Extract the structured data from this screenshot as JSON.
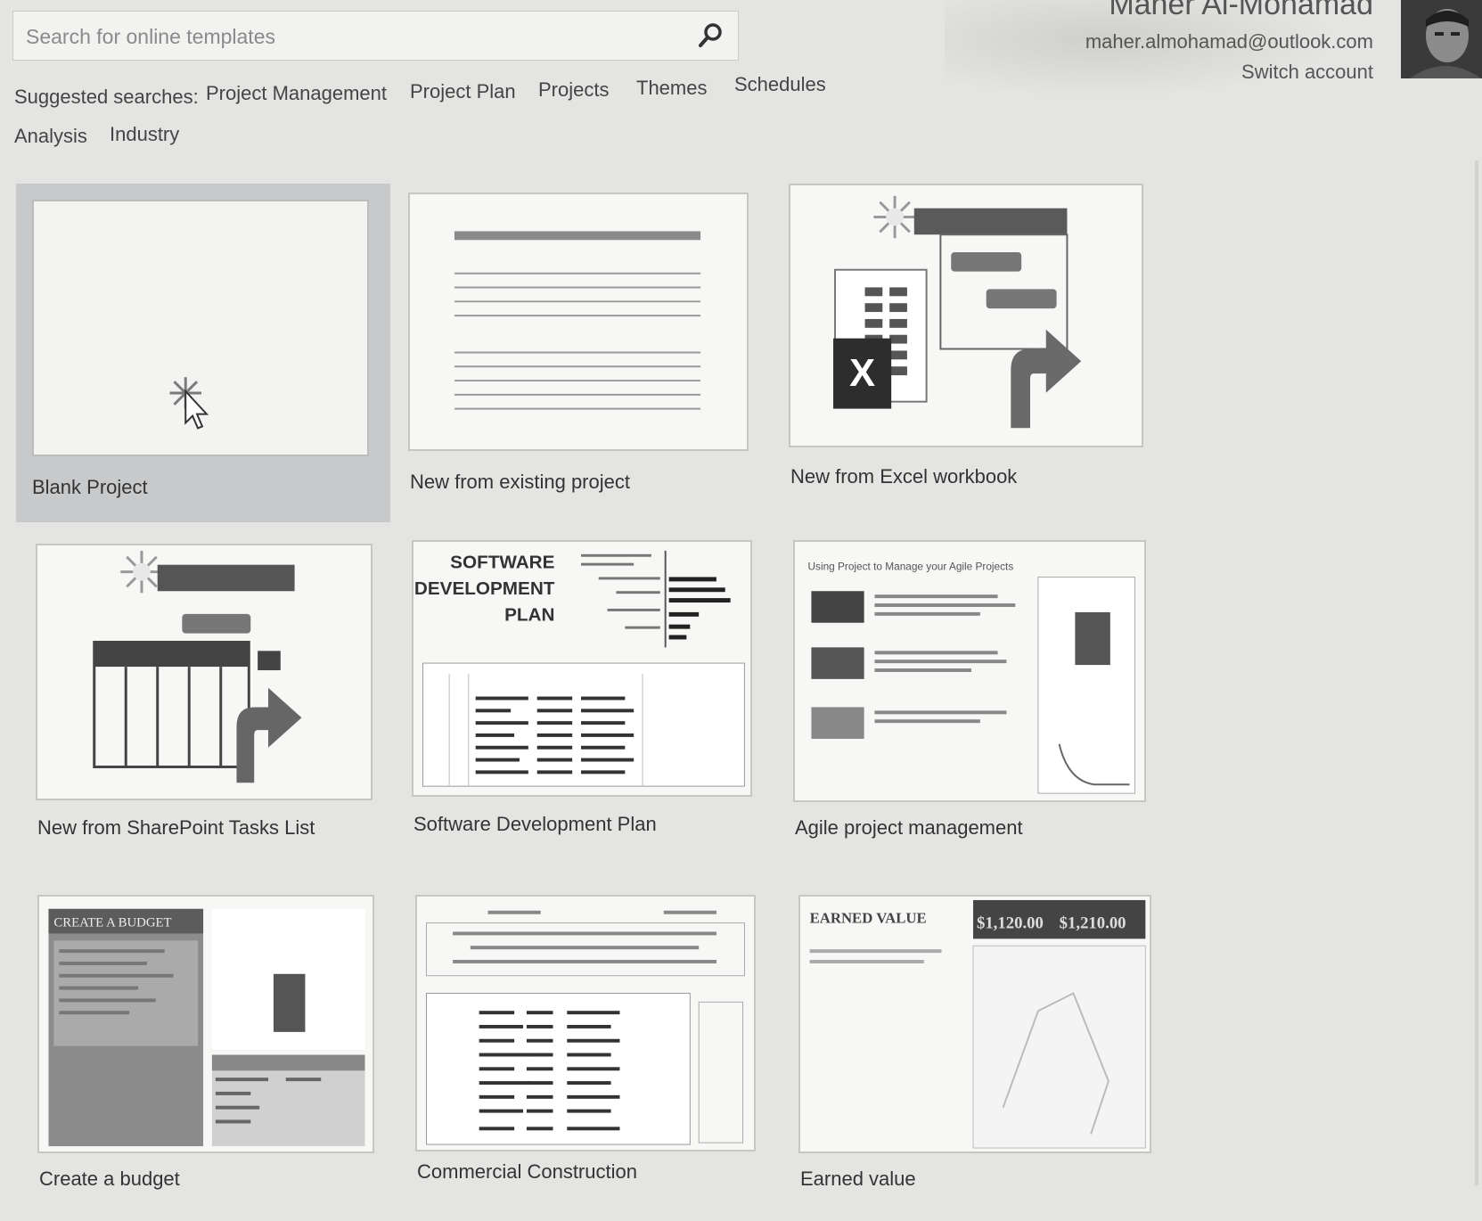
{
  "search": {
    "placeholder": "Search for online templates",
    "icon": "search-icon"
  },
  "suggested": {
    "label": "Suggested searches:",
    "links": [
      "Project Management",
      "Project Plan",
      "Projects",
      "Themes",
      "Schedules",
      "Analysis",
      "Industry"
    ]
  },
  "account": {
    "name": "Maher Al-Mohamad",
    "email": "maher.almohamad@outlook.com",
    "switch_label": "Switch account"
  },
  "templates": [
    {
      "label": "Blank Project",
      "selected": true
    },
    {
      "label": "New from existing project"
    },
    {
      "label": "New from Excel workbook"
    },
    {
      "label": "New from SharePoint Tasks List"
    },
    {
      "label": "Software Development Plan",
      "thumb_title": [
        "SOFTWARE",
        "DEVELOPMENT",
        "PLAN"
      ]
    },
    {
      "label": "Agile project management",
      "thumb_title": [
        "Using Project to Manage your Agile Projects"
      ]
    },
    {
      "label": "Create a budget",
      "thumb_title": [
        "CREATE A BUDGET"
      ]
    },
    {
      "label": "Commercial Construction"
    },
    {
      "label": "Earned value",
      "thumb_title": [
        "EARNED VALUE",
        "$1,120.00",
        "$1,210.00"
      ]
    }
  ],
  "colors": {
    "background": "#e4e4e2",
    "selected_tile": "#c8c9cb",
    "tile_bg": "#f7f7f6"
  }
}
